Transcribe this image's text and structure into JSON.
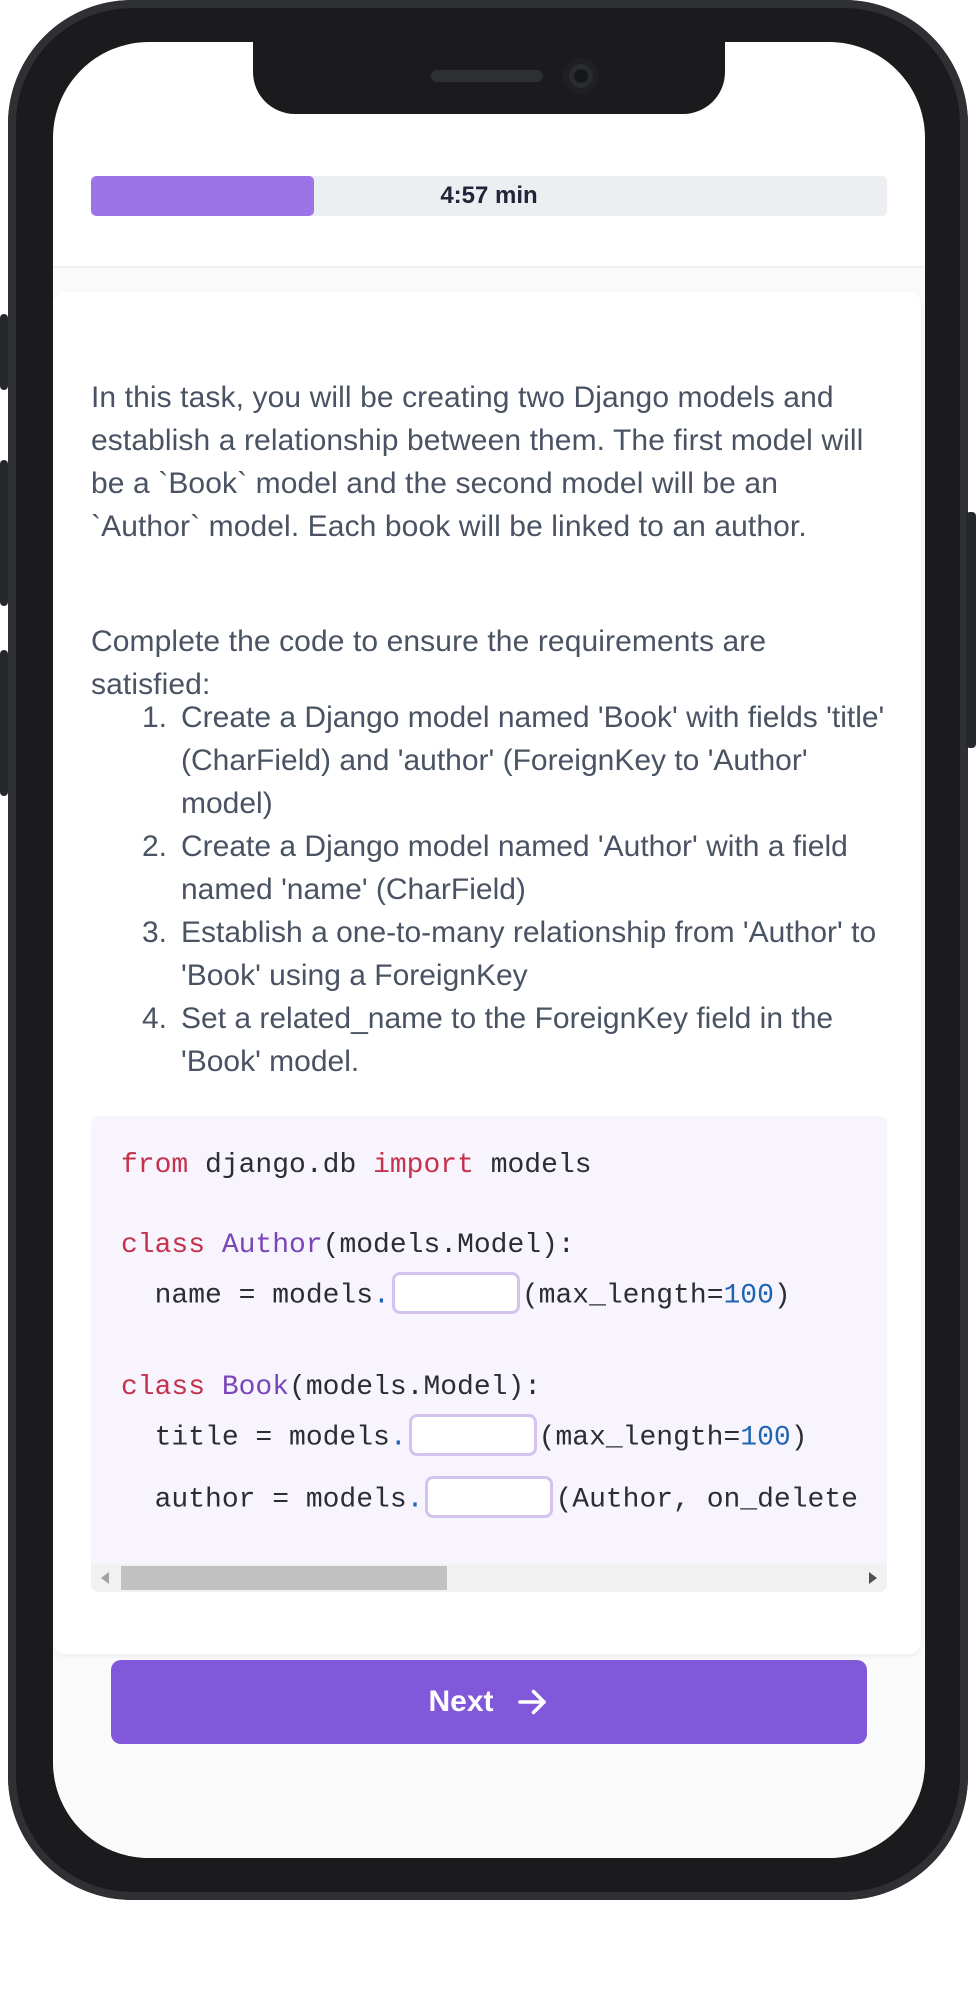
{
  "timer": {
    "label": "4:57 min",
    "progress_fraction": 0.28
  },
  "intro": {
    "paragraph1": "In this task, you will be creating two Django models and establish a relationship between them. The first model will be a `Book` model and the second model will be an `Author` model. Each book will be linked to an author.",
    "paragraph2": "Complete the code to ensure the requirements are satisfied:"
  },
  "requirements": [
    {
      "num": "1.",
      "text": "Create a Django model named 'Book' with fields 'title' (CharField) and 'author' (ForeignKey to 'Author' model)"
    },
    {
      "num": "2.",
      "text": "Create a Django model named 'Author' with a field named 'name' (CharField)"
    },
    {
      "num": "3.",
      "text": "Establish a one-to-many relationship from 'Author' to 'Book' using a ForeignKey"
    },
    {
      "num": "4.",
      "text": "Set a related_name to the ForeignKey field in the 'Book' model."
    }
  ],
  "code": {
    "line1": {
      "kw1": "from",
      "mod": " django.db ",
      "kw2": "import",
      "rest": " models"
    },
    "line2": {
      "kw": "class",
      "name": " Author",
      "rest": "(models.Model):"
    },
    "line3": {
      "pre": "  name = models",
      "dot": ".",
      "post": "(max_length=",
      "num": "100",
      "end": ")"
    },
    "line4": {
      "kw": "class",
      "name": " Book",
      "rest": "(models.Model):"
    },
    "line5": {
      "pre": "  title = models",
      "dot": ".",
      "post": "(max_length=",
      "num": "100",
      "end": ")"
    },
    "line6": {
      "pre": "  author = models",
      "dot": ".",
      "post": "(Author, on_delete"
    }
  },
  "scroll": {
    "thumb_fraction": 0.41
  },
  "next_button": {
    "label": "Next",
    "icon": "arrow-right-icon"
  },
  "colors": {
    "accent": "#8158d9",
    "progress": "#9d74e8",
    "keyword": "#c4324b",
    "class_name": "#7a45b6",
    "number": "#1f64b3"
  }
}
